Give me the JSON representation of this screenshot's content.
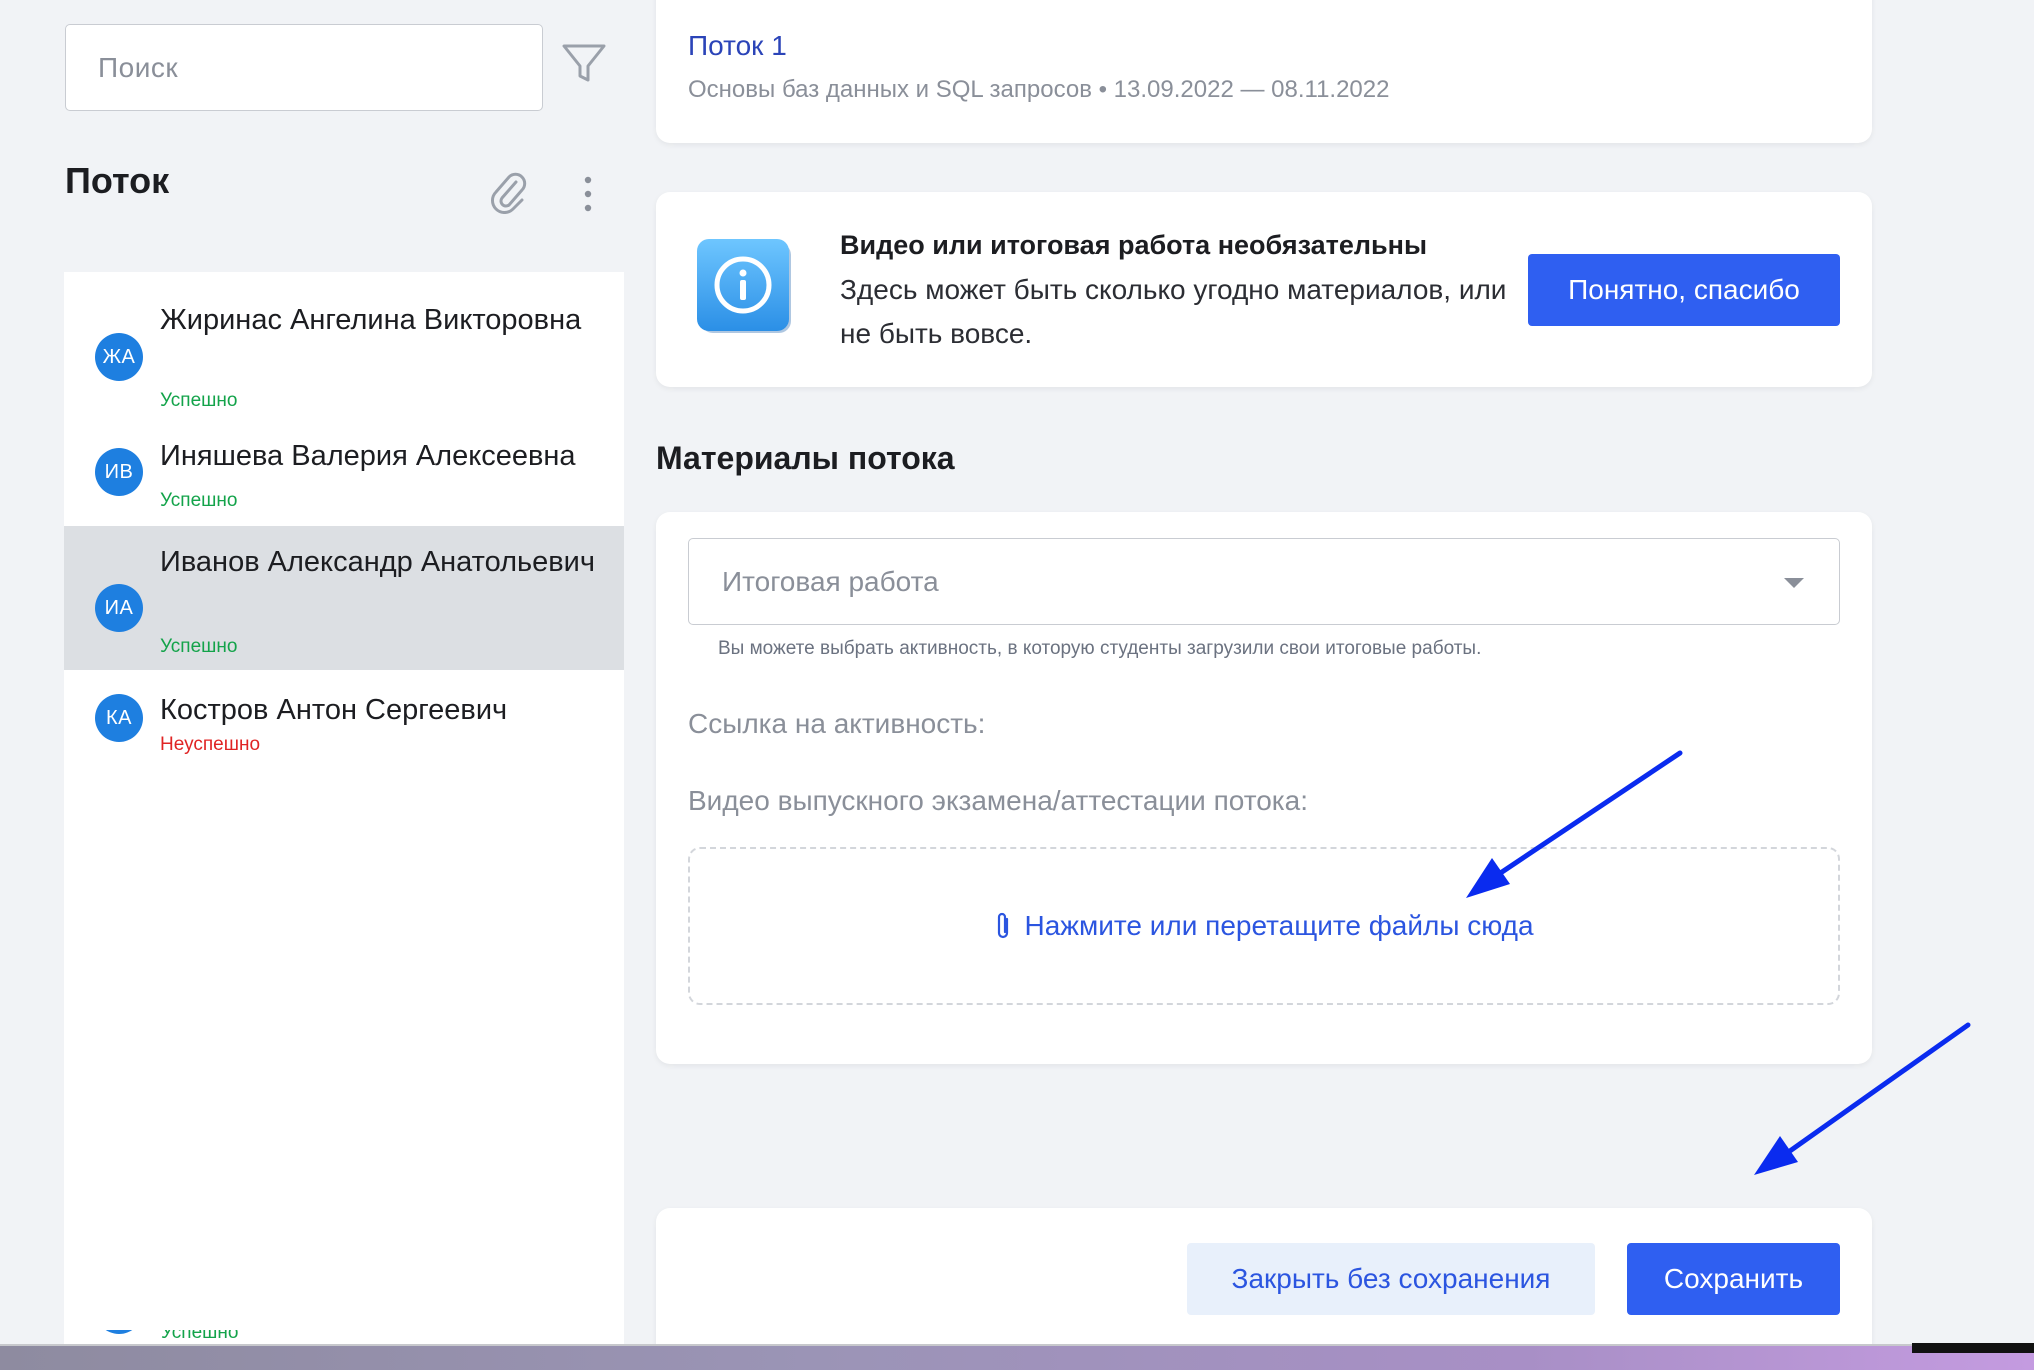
{
  "sidebar": {
    "search_placeholder": "Поиск",
    "title": "Поток",
    "students": [
      {
        "initials": "ЖА",
        "name": "Жиринас Ангелина Викторовна",
        "status": "Успешно",
        "state": "success"
      },
      {
        "initials": "ИВ",
        "name": "Иняшева Валерия Алексеевна",
        "status": "Успешно",
        "state": "success"
      },
      {
        "initials": "ИА",
        "name": "Иванов Александр Анатольевич",
        "status": "Успешно",
        "state": "success",
        "selected": true
      },
      {
        "initials": "КА",
        "name": "Костров Антон Сергеевич",
        "status": "Неуспешно",
        "state": "fail"
      }
    ],
    "tail_status": "Успешно"
  },
  "header": {
    "flow_title": "Поток 1",
    "flow_subtitle": "Основы баз данных и SQL запросов • 13.09.2022 — 08.11.2022"
  },
  "notice": {
    "title": "Видео или итоговая работа необязательны",
    "body": "Здесь может быть сколько угодно материалов, или не быть вовсе.",
    "button": "Понятно, спасибо"
  },
  "materials": {
    "title": "Материалы потока",
    "select_placeholder": "Итоговая работа",
    "select_hint": "Вы можете выбрать активность, в которую студенты загрузили свои итоговые работы.",
    "link_label": "Ссылка на активность:",
    "video_label": "Видео выпускного экзамена/аттестации потока:",
    "dropzone_text": "Нажмите или перетащите файлы сюда"
  },
  "footer": {
    "close_label": "Закрыть без сохранения",
    "save_label": "Сохранить"
  },
  "colors": {
    "primary": "#2f5ff1",
    "avatar": "#1e7fe0",
    "success": "#13a34a",
    "fail": "#e02424",
    "annotation_arrow": "#0a2bef"
  }
}
